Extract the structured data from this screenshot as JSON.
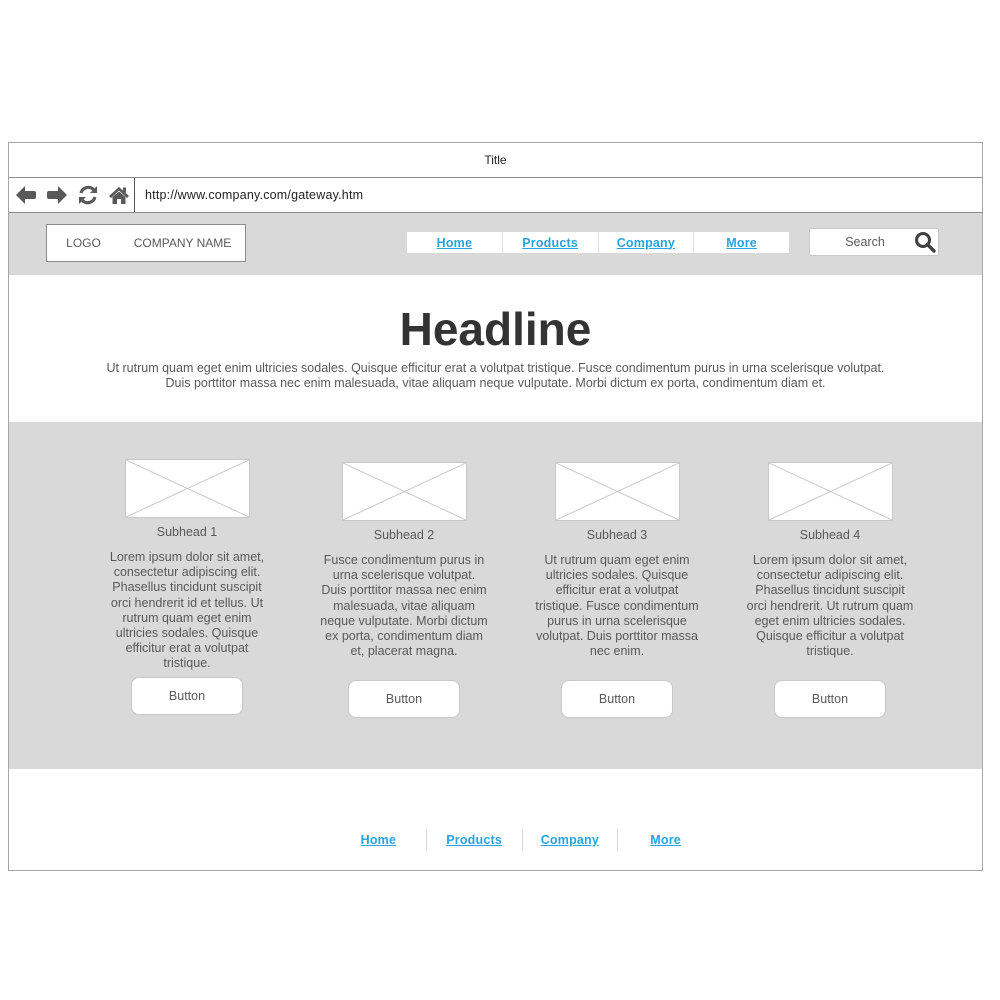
{
  "window": {
    "title": "Title"
  },
  "browser": {
    "url": "http://www.company.com/gateway.htm",
    "icons": [
      "back-arrow-icon",
      "forward-arrow-icon",
      "refresh-icon",
      "home-icon"
    ]
  },
  "header": {
    "logo": "LOGO",
    "company_name": "COMPANY NAME",
    "nav": [
      {
        "label": "Home"
      },
      {
        "label": "Products"
      },
      {
        "label": "Company"
      },
      {
        "label": "More"
      }
    ],
    "search": {
      "placeholder": "Search",
      "icon": "search-icon"
    }
  },
  "hero": {
    "headline": "Headline",
    "text": "Ut rutrum quam eget enim ultricies sodales. Quisque efficitur erat a volutpat tristique. Fusce condimentum purus in urna scelerisque volutpat. Duis porttitor massa nec enim malesuada, vitae aliquam neque vulputate. Morbi dictum ex porta, condimentum diam et."
  },
  "cards": [
    {
      "subhead": "Subhead 1",
      "body": "Lorem ipsum dolor sit amet, consectetur adipiscing elit. Phasellus tincidunt suscipit orci hendrerit id et tellus. Ut rutrum quam eget enim ultricies sodales. Quisque efficitur erat a volutpat tristique.",
      "button": "Button"
    },
    {
      "subhead": "Subhead 2",
      "body": "Fusce condimentum purus in urna scelerisque volutpat. Duis porttitor massa nec enim malesuada, vitae aliquam neque vulputate. Morbi dictum ex porta, condimentum diam et, placerat magna.",
      "button": "Button"
    },
    {
      "subhead": "Subhead 3",
      "body": "Ut rutrum quam eget enim ultricies sodales. Quisque efficitur erat a volutpat tristique. Fusce condimentum purus in urna scelerisque volutpat. Duis porttitor massa nec enim.",
      "button": "Button"
    },
    {
      "subhead": "Subhead 4",
      "body": "Lorem ipsum dolor sit amet, consectetur adipiscing elit. Phasellus tincidunt suscipit orci hendrerit. Ut rutrum quam eget enim ultricies sodales. Quisque efficitur a volutpat tristique.",
      "button": "Button"
    }
  ],
  "footer": {
    "nav": [
      {
        "label": "Home"
      },
      {
        "label": "Products"
      },
      {
        "label": "Company"
      },
      {
        "label": "More"
      }
    ]
  },
  "colors": {
    "link": "#29a3e0",
    "band_gray": "#d9d9d9",
    "text": "#595959",
    "headline": "#333333"
  }
}
